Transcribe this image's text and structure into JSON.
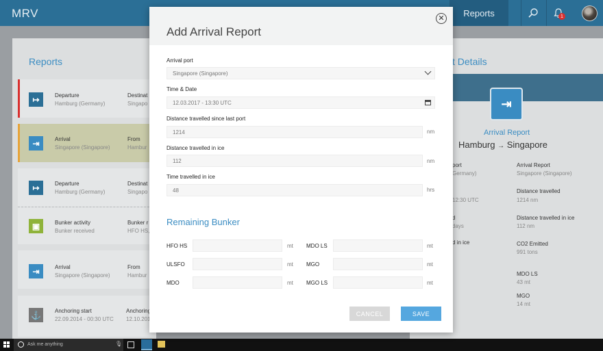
{
  "app": {
    "logo": "MRV",
    "nav_reports": "Reports",
    "notification_count": "1"
  },
  "left_panel": {
    "title": "Reports",
    "cards": [
      {
        "type": "Departure",
        "sub": "Hamburg (Germany)",
        "col_label": "Destinat",
        "col_value": "Singapo",
        "accent": "#d9302f",
        "icon_color": "#2b6f96"
      },
      {
        "type": "Arrival",
        "sub": "Singapore (Singapore)",
        "col_label": "From",
        "col_value": "Hambur",
        "accent": "#e8a43a",
        "icon_color": "#3a8cc2"
      },
      {
        "type": "Departure",
        "sub": "Hamburg (Germany)",
        "col_label": "Destinat",
        "col_value": "Singapo",
        "accent": "",
        "icon_color": "#2b6f96"
      },
      {
        "type": "Bunker activity",
        "sub": "Bunker received",
        "col_label": "Bunker r",
        "col_value": "HFO HS,",
        "accent": "",
        "icon_color": "#8fb33a"
      },
      {
        "type": "Arrival",
        "sub": "Singapore (Singapore)",
        "col_label": "From",
        "col_value": "Hambur",
        "accent": "",
        "icon_color": "#3a8cc2"
      },
      {
        "type": "Anchoring start",
        "sub": "22.09.2014 - 00:30 UTC",
        "col_label": "Anchoring",
        "col_value": "12.10.201",
        "accent": "",
        "icon_color": "#777"
      }
    ]
  },
  "right_panel": {
    "title": "Details",
    "title_prefix": "t",
    "report_type": "Arrival Report",
    "route_from": "Hamburg",
    "route_arrow": "→",
    "route_to": "Singapore",
    "left_col": [
      {
        "label": "port",
        "value": "Germany)"
      },
      {
        "label": "",
        "value": "12:30 UTC"
      },
      {
        "label": "d",
        "value": "days"
      },
      {
        "label": "d in ice",
        "value": ""
      }
    ],
    "right_col": [
      {
        "label": "Arrival Report",
        "value": "Singapore (Singapore)"
      },
      {
        "label": "Distance travelled",
        "value": "1214 nm"
      },
      {
        "label": "Distance travelled in ice",
        "value": "112 nm"
      },
      {
        "label": "CO2 Emitted",
        "value": "991 tons"
      },
      {
        "label": "MDO LS",
        "value": "43 mt"
      },
      {
        "label": "MGO",
        "value": "14 mt"
      }
    ]
  },
  "modal": {
    "title": "Add Arrival Report",
    "fields": {
      "arrival_port": {
        "label": "Arrival port",
        "value": "Singapore (Singapore)"
      },
      "time_date": {
        "label": "Time & Date",
        "value": "12.03.2017 - 13:30 UTC"
      },
      "distance": {
        "label": "Distance travelled since last port",
        "value": "1214",
        "unit": "nm"
      },
      "distance_ice": {
        "label": "Distance travelled in ice",
        "value": "112",
        "unit": "nm"
      },
      "time_ice": {
        "label": "Time travelled in ice",
        "value": "48",
        "unit": "hrs"
      }
    },
    "bunker_title": "Remaining Bunker",
    "bunker": [
      {
        "label": "HFO HS",
        "unit": "mt"
      },
      {
        "label": "MDO LS",
        "unit": "mt"
      },
      {
        "label": "ULSFO",
        "unit": "mt"
      },
      {
        "label": "MGO",
        "unit": "mt"
      },
      {
        "label": "MDO",
        "unit": "mt"
      },
      {
        "label": "MGO LS",
        "unit": "mt"
      }
    ],
    "cancel_label": "CANCEL",
    "save_label": "SAVE"
  },
  "taskbar": {
    "search_placeholder": "Ask me anything"
  }
}
